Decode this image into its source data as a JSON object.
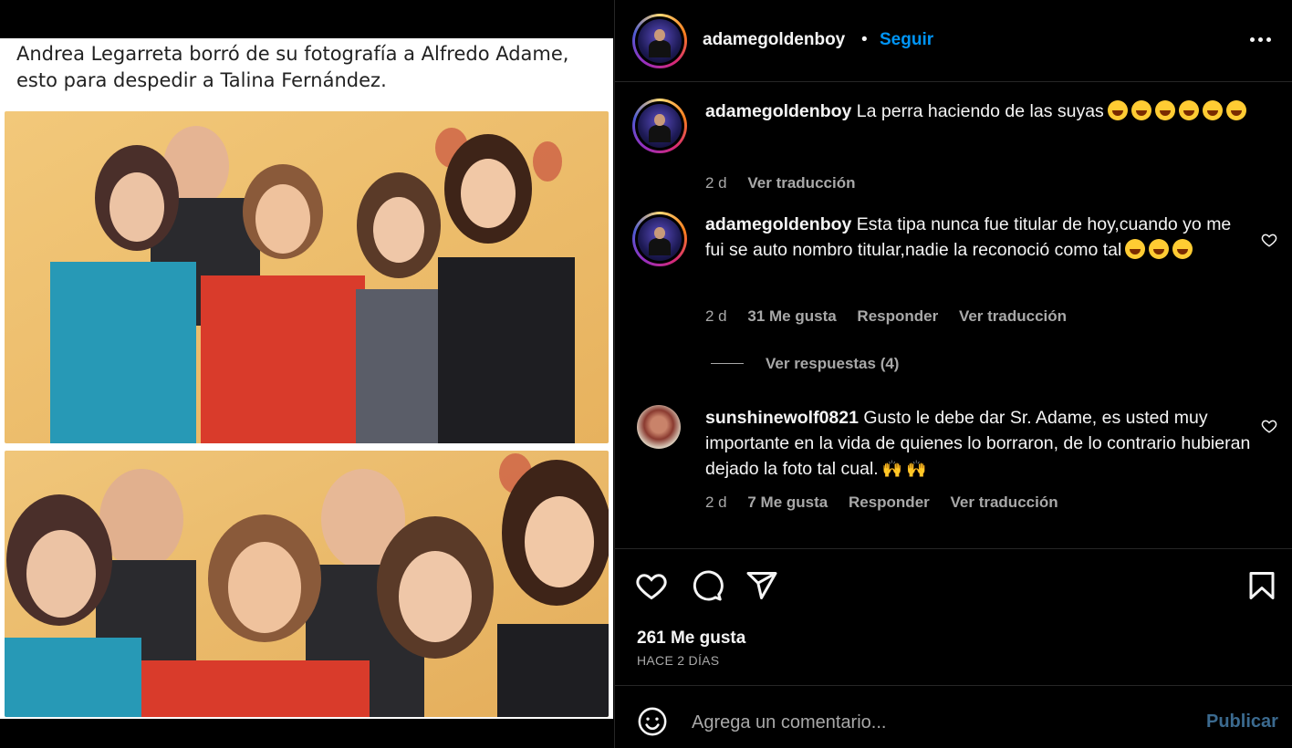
{
  "media": {
    "caption": "Andrea Legarreta borró de su fotografía a Alfredo Adame, esto para despedir a Talina Fernández."
  },
  "header": {
    "username": "adamegoldenboy",
    "dot": "•",
    "follow_label": "Seguir"
  },
  "comments": [
    {
      "username": "adamegoldenboy",
      "text": "La perra haciendo de las suyas",
      "time": "2 d",
      "likes": "",
      "reply_label": "",
      "translate_label": "Ver traducción"
    },
    {
      "username": "adamegoldenboy",
      "text": "Esta tipa nunca fue titular de hoy,cuando yo me fui se auto nombro titular,nadie la reconoció como tal",
      "time": "2 d",
      "likes": "31 Me gusta",
      "reply_label": "Responder",
      "translate_label": "Ver traducción"
    },
    {
      "username": "sunshinewolf0821",
      "text": "Gusto le debe dar Sr. Adame, es usted muy importante en la vida de quienes lo borraron, de lo contrario hubieran dejado la foto tal cual.",
      "time": "2 d",
      "likes": "7 Me gusta",
      "reply_label": "Responder",
      "translate_label": "Ver traducción"
    }
  ],
  "replies_label": "Ver respuestas (4)",
  "footer": {
    "likes": "261 Me gusta",
    "ago": "HACE 2 DÍAS",
    "comment_placeholder": "Agrega un comentario...",
    "publish_label": "Publicar"
  },
  "icons": {
    "like": "heart-icon",
    "comment": "comment-icon",
    "share": "share-icon",
    "save": "bookmark-icon",
    "more": "more-icon",
    "emoji": "emoji-icon"
  }
}
